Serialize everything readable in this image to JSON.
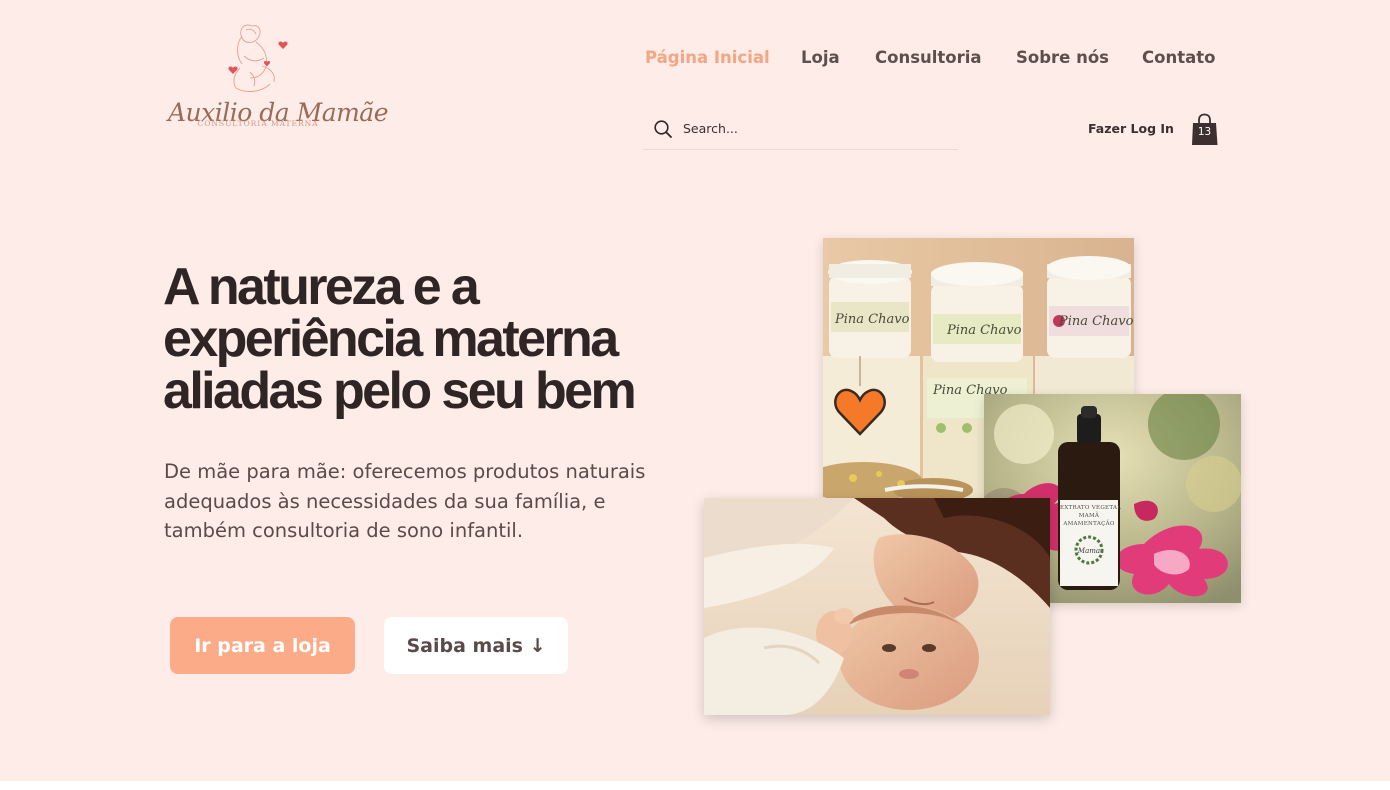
{
  "logo": {
    "script_text": "Auxilio da Mamãe",
    "subtitle": "CONSULTORIA MATERNA"
  },
  "nav": {
    "items": [
      {
        "label": "Página Inicial",
        "active": true
      },
      {
        "label": "Loja",
        "active": false
      },
      {
        "label": "Consultoria",
        "active": false
      },
      {
        "label": "Sobre nós",
        "active": false
      },
      {
        "label": "Contato",
        "active": false
      }
    ]
  },
  "search": {
    "placeholder": "Search...",
    "icon": "search-icon"
  },
  "account": {
    "login_label": "Fazer Log In",
    "cart_count": "13",
    "cart_icon": "shopping-bag-icon"
  },
  "hero": {
    "title_lines": [
      "A natureza e a",
      "experiência materna",
      "aliadas pelo seu bem"
    ],
    "subtitle_lines": [
      "De mãe para mãe: oferecemos produtos naturais",
      "adequados às necessidades da sua família, e",
      "também consultoria de sono infantil."
    ],
    "primary_button": "Ir para a loja",
    "secondary_button": "Saiba mais ↓"
  },
  "collage": {
    "jar_brand": "Pina Chavo",
    "bottle_label_lines": [
      "EXTRATO VEGETAL",
      "MAMÃ",
      "AMAMENTAÇÃO"
    ]
  },
  "colors": {
    "background": "#fdece7",
    "accent": "#fbab87",
    "nav_active": "#f4a583",
    "heading": "#2f2524",
    "body_text": "#5a4b49"
  }
}
